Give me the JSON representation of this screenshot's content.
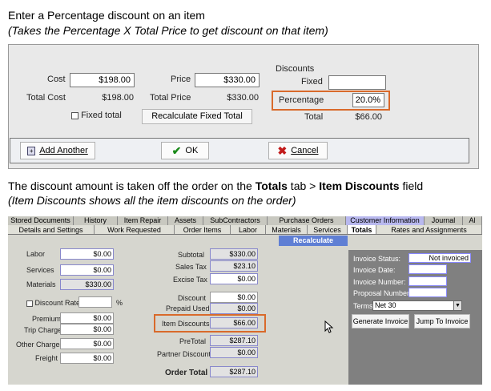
{
  "caption1": {
    "title": "Enter a Percentage discount on an item",
    "subtitle": "(Takes the Percentage X Total Price to get discount on that item)"
  },
  "item_panel": {
    "cost_label": "Cost",
    "cost_value": "$198.00",
    "price_label": "Price",
    "price_value": "$330.00",
    "total_cost_label": "Total Cost",
    "total_cost_value": "$198.00",
    "total_price_label": "Total Price",
    "total_price_value": "$330.00",
    "fixed_total_label": "Fixed total",
    "recalc_button": "Recalculate Fixed Total",
    "discounts_header": "Discounts",
    "fixed_label": "Fixed",
    "fixed_value": "",
    "percentage_label": "Percentage",
    "percentage_value": "20.0%",
    "total_label": "Total",
    "total_value": "$66.00",
    "add_another": "Add Another",
    "ok": "OK",
    "cancel": "Cancel"
  },
  "caption2": {
    "text_a": "The discount amount is taken off the order on the ",
    "text_b": "Totals",
    "text_c": " tab > ",
    "text_d": "Item Discounts",
    "text_e": " field",
    "subtitle": "(Item Discounts shows all the item discounts on the order)"
  },
  "tabs_back": [
    "Stored Documents",
    "History",
    "Item Repair",
    "Assets",
    "SubContractors",
    "Purchase Orders",
    "Customer Information",
    "Journal",
    "Al"
  ],
  "tabs_front": [
    "Details and Settings",
    "Work Requested",
    "Order Items",
    "Labor",
    "Materials",
    "Services",
    "Totals",
    "Rates and Assignments"
  ],
  "recalculate": "Recalculate",
  "left_col": {
    "labor_label": "Labor",
    "labor_value": "$0.00",
    "services_label": "Services",
    "services_value": "$0.00",
    "materials_label": "Materials",
    "materials_value": "$330.00",
    "discount_rate_label": "Discount Rate",
    "percent_sign": "%",
    "premium_label": "Premium",
    "premium_value": "$0.00",
    "trip_label": "Trip Charge",
    "trip_value": "$0.00",
    "other_label": "Other Charges",
    "other_value": "$0.00",
    "freight_label": "Freight",
    "freight_value": "$0.00"
  },
  "mid_col": {
    "subtotal_label": "Subtotal",
    "subtotal_value": "$330.00",
    "salestax_label": "Sales Tax",
    "salestax_value": "$23.10",
    "excise_label": "Excise Tax",
    "excise_value": "$0.00",
    "discount_label": "Discount",
    "discount_value": "$0.00",
    "prepaid_label": "Prepaid Used",
    "prepaid_value": "$0.00",
    "itemdisc_label": "Item Discounts",
    "itemdisc_value": "$66.00",
    "pretotal_label": "PreTotal",
    "pretotal_value": "$287.10",
    "partner_label": "Partner Discount",
    "partner_value": "$0.00",
    "ordertotal_label": "Order Total",
    "ordertotal_value": "$287.10"
  },
  "right_col": {
    "status_label": "Invoice Status:",
    "status_value": "Not invoiced",
    "date_label": "Invoice Date:",
    "number_label": "Invoice Number:",
    "proposal_label": "Proposal Number:",
    "terms_label": "Terms",
    "terms_value": "Net 30",
    "generate": "Generate Invoice",
    "jump": "Jump To Invoice"
  }
}
